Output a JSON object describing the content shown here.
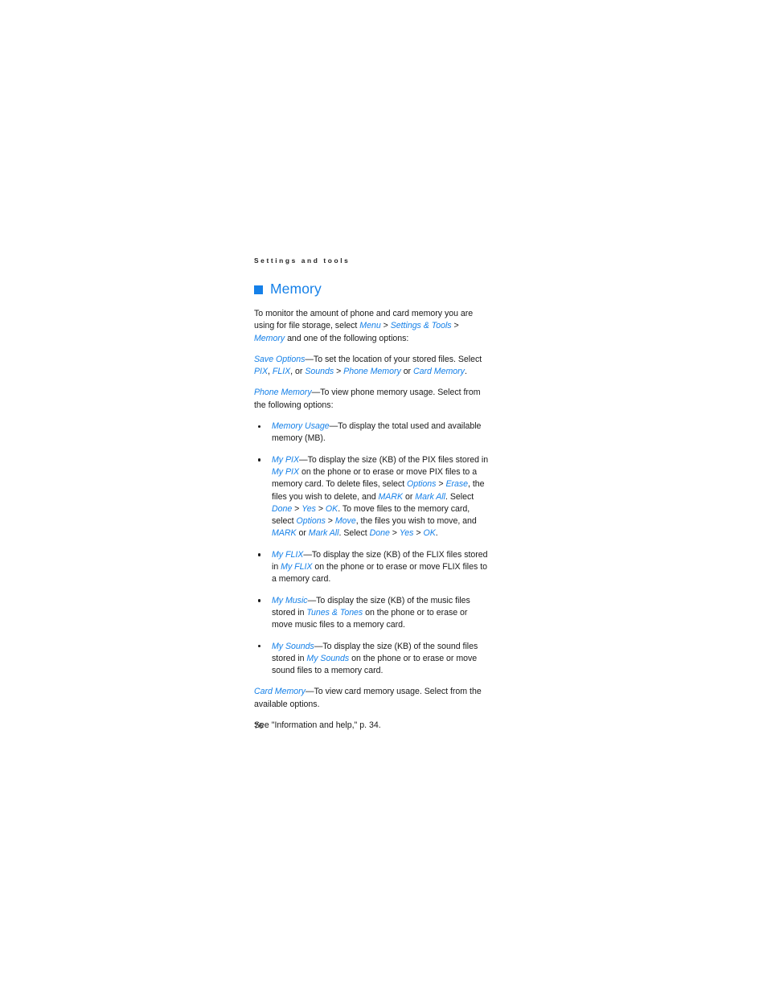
{
  "page": {
    "running_header": "Settings and tools",
    "folio": "76",
    "accent_color": "#1580e8",
    "text_color": "#1a1a1a"
  },
  "heading": {
    "marker_icon": "filled-square-icon",
    "title": "Memory"
  },
  "intro": {
    "line1": "To monitor the amount of phone and card memory you are using for file storage, select ",
    "menu": "Menu",
    "sep1": " > ",
    "settings_tools": "Settings & Tools",
    "sep2": " > ",
    "memory": "Memory",
    "line2": " and one of the following options:"
  },
  "save_options": {
    "term": "Save Options",
    "t1": "—To set the location of your stored files. Select ",
    "pix": "PIX",
    "c1": ", ",
    "flix": "FLIX",
    "t2": ", or ",
    "sounds": "Sounds",
    "sep1": " > ",
    "phone_memory": "Phone Memory",
    "t3": " or ",
    "card_memory": "Card Memory",
    "t4": "."
  },
  "phone_memory": {
    "term": "Phone Memory",
    "text": "—To view phone memory usage. Select from the following options:"
  },
  "bullets": [
    {
      "name": "memory-usage",
      "term": "Memory Usage",
      "text": "—To display the total used and available memory (MB)."
    },
    {
      "name": "my-pix",
      "term": "My PIX",
      "t1": "—To display the size (KB) of the PIX files stored in ",
      "term2": "My PIX",
      "t2": " on the phone or to erase or move PIX files to a memory card. To delete files, select ",
      "options1": "Options",
      "sep1": " > ",
      "erase": "Erase",
      "t3": ", the files you wish to delete, and ",
      "mark1": "MARK",
      "t4": " or ",
      "mark_all1": "Mark All",
      "t5": ". Select ",
      "done1": "Done",
      "sep2": " > ",
      "yes1": "Yes",
      "sep3": " > ",
      "ok1": "OK",
      "t6": ". To move files to the memory card, select ",
      "options2": "Options",
      "sep4": " > ",
      "move": "Move",
      "t7": ", the files you wish to move, and ",
      "mark2": "MARK",
      "t8": " or ",
      "mark_all2": "Mark All",
      "t9": ". Select ",
      "done2": "Done",
      "sep5": " > ",
      "yes2": "Yes",
      "sep6": " > ",
      "ok2": "OK",
      "t10": "."
    },
    {
      "name": "my-flix",
      "term": "My FLIX",
      "t1": "—To display the size (KB) of the FLIX files stored in ",
      "term2": "My FLIX",
      "t2": " on the phone or to erase or move FLIX files to a memory card."
    },
    {
      "name": "my-music",
      "term": "My Music",
      "t1": "—To display the size (KB) of the music files stored in ",
      "term2": "Tunes & Tones",
      "t2": " on the phone or to erase or move music files to a memory card."
    },
    {
      "name": "my-sounds",
      "term": "My Sounds",
      "t1": "—To display the size (KB) of the sound files stored in ",
      "term2": "My Sounds",
      "t2": " on the phone or to erase or move sound files to a memory card."
    }
  ],
  "card_memory": {
    "term": "Card Memory",
    "text": "—To view card memory usage. Select from the available options."
  },
  "cross_reference": {
    "text": "See \"Information and help,\" p. 34."
  }
}
